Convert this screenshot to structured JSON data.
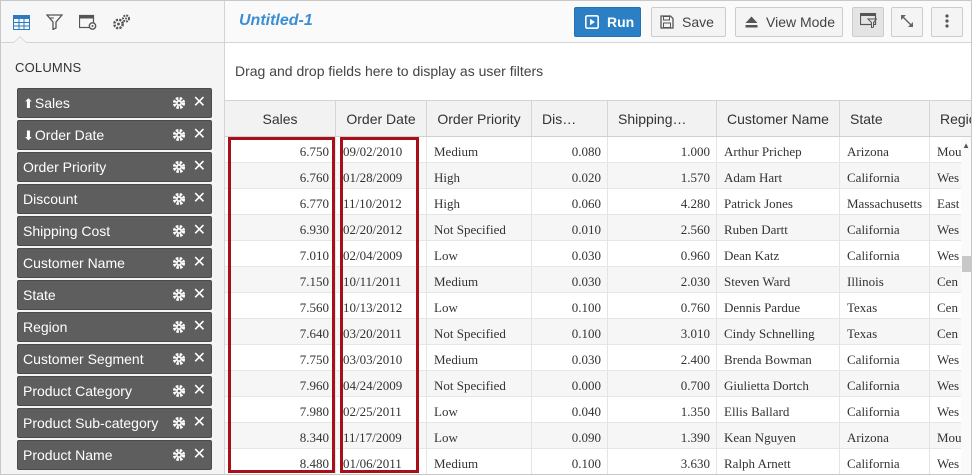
{
  "sidebar": {
    "section_title": "COLUMNS",
    "columns": [
      {
        "label": "Sales",
        "sort": "⬆"
      },
      {
        "label": "Order Date",
        "sort": "⬇"
      },
      {
        "label": "Order Priority",
        "sort": ""
      },
      {
        "label": "Discount",
        "sort": ""
      },
      {
        "label": "Shipping Cost",
        "sort": ""
      },
      {
        "label": "Customer Name",
        "sort": ""
      },
      {
        "label": "State",
        "sort": ""
      },
      {
        "label": "Region",
        "sort": ""
      },
      {
        "label": "Customer Segment",
        "sort": ""
      },
      {
        "label": "Product Category",
        "sort": ""
      },
      {
        "label": "Product Sub-category",
        "sort": ""
      },
      {
        "label": "Product Name",
        "sort": ""
      }
    ],
    "remove_glyph": "✕"
  },
  "toolbar": {
    "title": "Untitled-1",
    "run_label": "Run",
    "save_label": "Save",
    "view_mode_label": "View Mode"
  },
  "filter_zone": {
    "hint": "Drag and drop fields here to display as user filters"
  },
  "grid": {
    "headers": [
      "Sales",
      "Order Date",
      "Order Priority",
      "Dis…",
      "Shipping…",
      "Customer Name",
      "State",
      "Regio"
    ],
    "rows": [
      [
        "6.750",
        "09/02/2010",
        "Medium",
        "0.080",
        "1.000",
        "Arthur Prichep",
        "Arizona",
        "Mou"
      ],
      [
        "6.760",
        "01/28/2009",
        "High",
        "0.020",
        "1.570",
        "Adam Hart",
        "California",
        "Wes"
      ],
      [
        "6.770",
        "11/10/2012",
        "High",
        "0.060",
        "4.280",
        "Patrick Jones",
        "Massachusetts",
        "East"
      ],
      [
        "6.930",
        "02/20/2012",
        "Not Specified",
        "0.010",
        "2.560",
        "Ruben Dartt",
        "California",
        "Wes"
      ],
      [
        "7.010",
        "02/04/2009",
        "Low",
        "0.030",
        "0.960",
        "Dean Katz",
        "California",
        "Wes"
      ],
      [
        "7.150",
        "10/11/2011",
        "Medium",
        "0.030",
        "2.030",
        "Steven Ward",
        "Illinois",
        "Cen"
      ],
      [
        "7.560",
        "10/13/2012",
        "Low",
        "0.100",
        "0.760",
        "Dennis Pardue",
        "Texas",
        "Cen"
      ],
      [
        "7.640",
        "03/20/2011",
        "Not Specified",
        "0.100",
        "3.010",
        "Cindy Schnelling",
        "Texas",
        "Cen"
      ],
      [
        "7.750",
        "03/03/2010",
        "Medium",
        "0.030",
        "2.400",
        "Brenda Bowman",
        "California",
        "Wes"
      ],
      [
        "7.960",
        "04/24/2009",
        "Not Specified",
        "0.000",
        "0.700",
        "Giulietta Dortch",
        "California",
        "Wes"
      ],
      [
        "7.980",
        "02/25/2011",
        "Low",
        "0.040",
        "1.350",
        "Ellis Ballard",
        "California",
        "Wes"
      ],
      [
        "8.340",
        "11/17/2009",
        "Low",
        "0.090",
        "1.390",
        "Kean Nguyen",
        "Arizona",
        "Mou"
      ],
      [
        "8.480",
        "01/06/2011",
        "Medium",
        "0.100",
        "3.630",
        "Ralph Arnett",
        "California",
        "Wes"
      ]
    ]
  },
  "colors": {
    "accent": "#2b7fc4",
    "title": "#3a8fd4",
    "column_chip": "#5e5e5e",
    "highlight": "#a80f18"
  }
}
